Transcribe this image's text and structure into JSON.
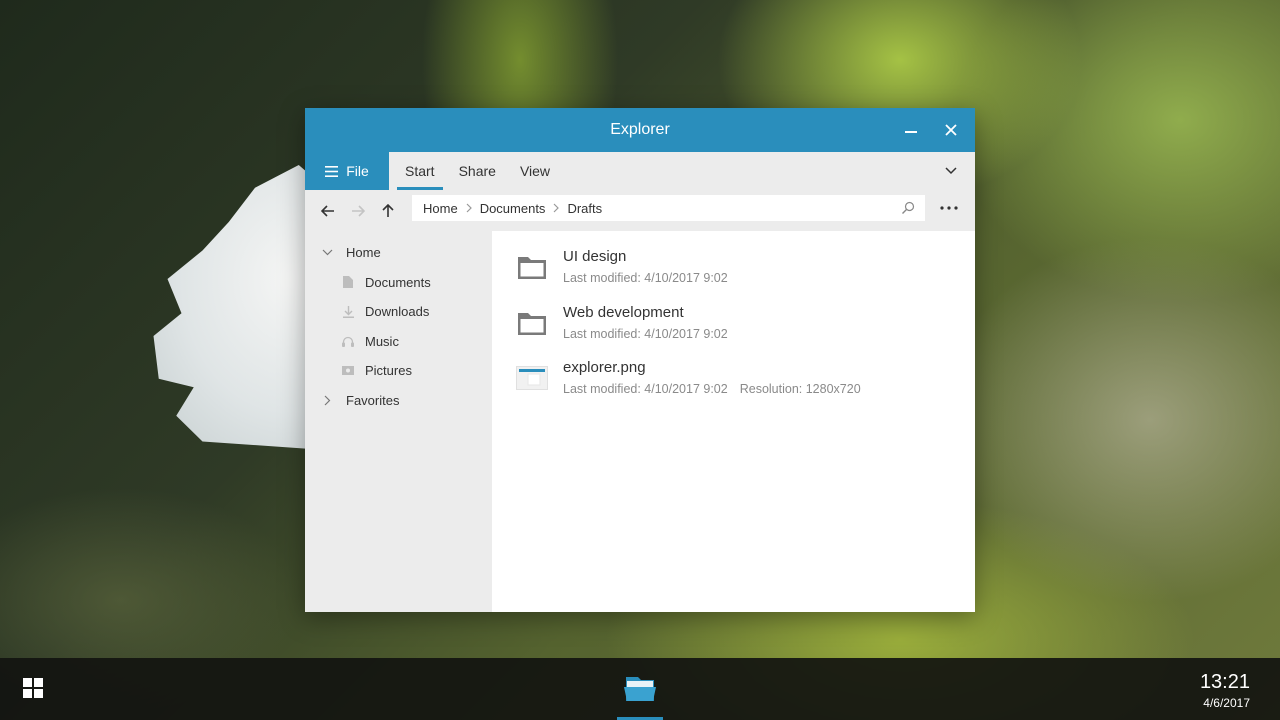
{
  "window": {
    "title": "Explorer",
    "accent": "#2a8ebc"
  },
  "ribbon": {
    "file_label": "File",
    "tabs": [
      {
        "label": "Start",
        "active": true
      },
      {
        "label": "Share",
        "active": false
      },
      {
        "label": "View",
        "active": false
      }
    ]
  },
  "address": {
    "crumbs": [
      "Home",
      "Documents",
      "Drafts"
    ]
  },
  "sidebar": {
    "home_label": "Home",
    "items": [
      {
        "label": "Documents",
        "icon": "document-icon"
      },
      {
        "label": "Downloads",
        "icon": "download-icon"
      },
      {
        "label": "Music",
        "icon": "headphones-icon"
      },
      {
        "label": "Pictures",
        "icon": "picture-icon"
      }
    ],
    "favorites_label": "Favorites"
  },
  "files": [
    {
      "name": "UI design",
      "type": "folder",
      "modified": "Last modified: 4/10/2017 9:02"
    },
    {
      "name": "Web development",
      "type": "folder",
      "modified": "Last modified: 4/10/2017 9:02"
    },
    {
      "name": "explorer.png",
      "type": "image",
      "modified": "Last modified: 4/10/2017 9:02",
      "resolution": "Resolution: 1280x720"
    }
  ],
  "taskbar": {
    "time": "13:21",
    "date": "4/6/2017"
  }
}
